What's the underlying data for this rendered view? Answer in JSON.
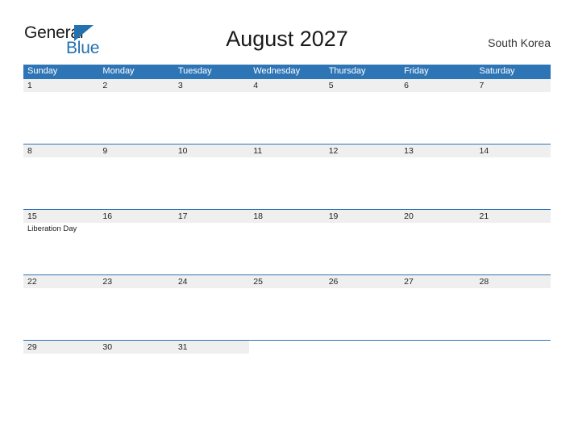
{
  "brand": {
    "name_part1": "General",
    "name_part2": "Blue",
    "flag_icon": "triangle-flag-icon",
    "color_dark": "#1a1a1a",
    "color_blue": "#2471b0"
  },
  "header": {
    "title": "August 2027",
    "month": "August",
    "year": "2027",
    "region": "South Korea"
  },
  "theme": {
    "header_blue": "#2e75b6",
    "date_band_gray": "#efefef",
    "rule_blue": "#2e75b6",
    "text_dark": "#222222",
    "background": "#ffffff"
  },
  "calendar": {
    "weekdays": [
      "Sunday",
      "Monday",
      "Tuesday",
      "Wednesday",
      "Thursday",
      "Friday",
      "Saturday"
    ],
    "weeks": [
      {
        "days": [
          {
            "date": "1",
            "events": []
          },
          {
            "date": "2",
            "events": []
          },
          {
            "date": "3",
            "events": []
          },
          {
            "date": "4",
            "events": []
          },
          {
            "date": "5",
            "events": []
          },
          {
            "date": "6",
            "events": []
          },
          {
            "date": "7",
            "events": []
          }
        ]
      },
      {
        "days": [
          {
            "date": "8",
            "events": []
          },
          {
            "date": "9",
            "events": []
          },
          {
            "date": "10",
            "events": []
          },
          {
            "date": "11",
            "events": []
          },
          {
            "date": "12",
            "events": []
          },
          {
            "date": "13",
            "events": []
          },
          {
            "date": "14",
            "events": []
          }
        ]
      },
      {
        "days": [
          {
            "date": "15",
            "events": [
              "Liberation Day"
            ]
          },
          {
            "date": "16",
            "events": []
          },
          {
            "date": "17",
            "events": []
          },
          {
            "date": "18",
            "events": []
          },
          {
            "date": "19",
            "events": []
          },
          {
            "date": "20",
            "events": []
          },
          {
            "date": "21",
            "events": []
          }
        ]
      },
      {
        "days": [
          {
            "date": "22",
            "events": []
          },
          {
            "date": "23",
            "events": []
          },
          {
            "date": "24",
            "events": []
          },
          {
            "date": "25",
            "events": []
          },
          {
            "date": "26",
            "events": []
          },
          {
            "date": "27",
            "events": []
          },
          {
            "date": "28",
            "events": []
          }
        ]
      },
      {
        "days": [
          {
            "date": "29",
            "events": []
          },
          {
            "date": "30",
            "events": []
          },
          {
            "date": "31",
            "events": []
          },
          {
            "date": "",
            "events": []
          },
          {
            "date": "",
            "events": []
          },
          {
            "date": "",
            "events": []
          },
          {
            "date": "",
            "events": []
          }
        ]
      }
    ]
  }
}
